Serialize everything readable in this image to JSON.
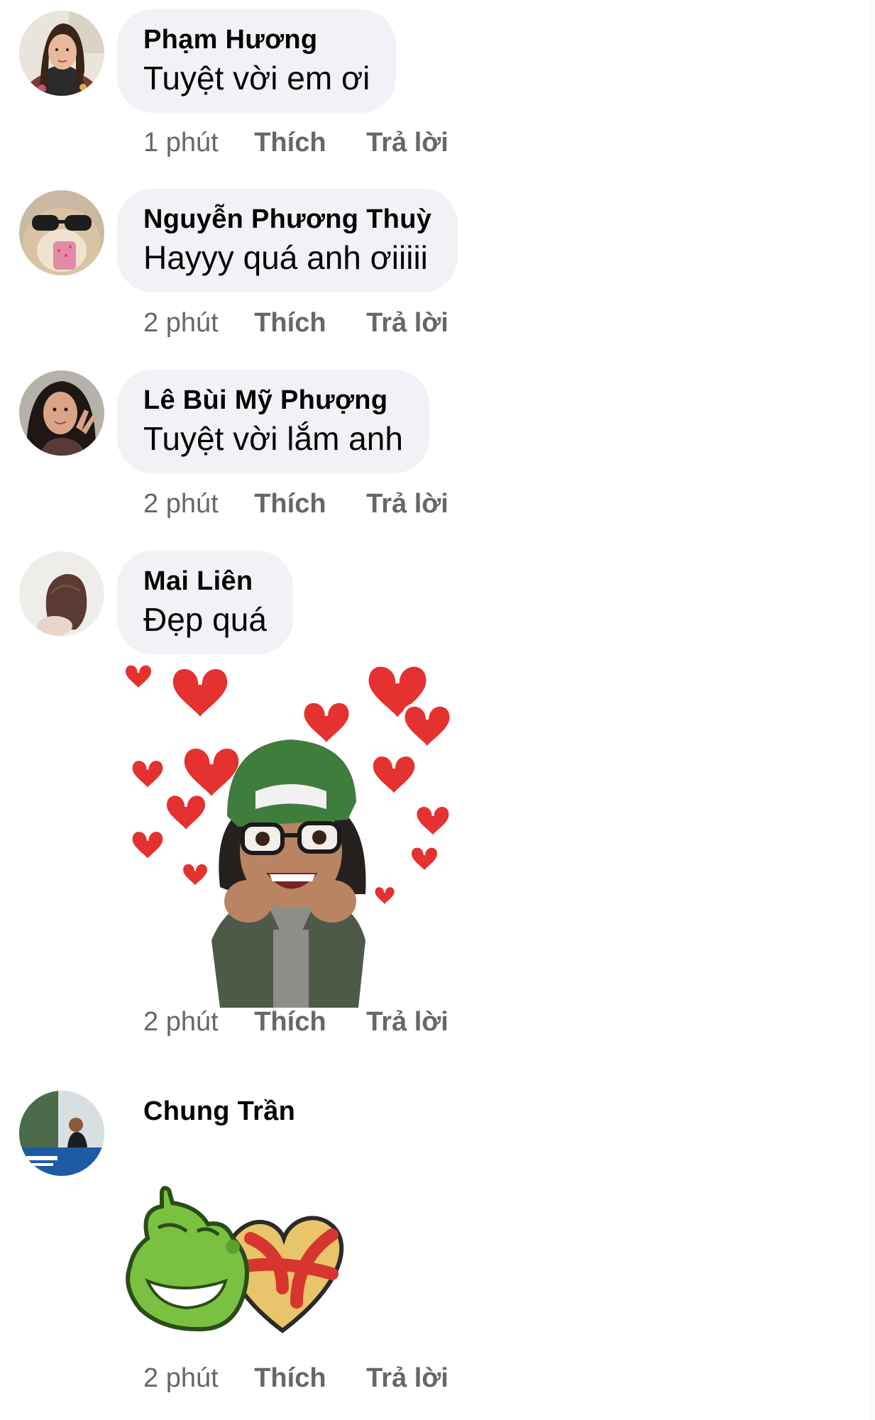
{
  "comments": [
    {
      "name": "Phạm Hương",
      "text": "Tuyệt vời em ơi",
      "time": "1 phút",
      "like": "Thích",
      "reply": "Trả lời",
      "avatar": "woman-portrait-avatar"
    },
    {
      "name": "Nguyễn Phương Thuỳ",
      "text": "Hayyy quá anh ơiiiii",
      "time": "2 phút",
      "like": "Thích",
      "reply": "Trả lời",
      "avatar": "hamster-sunglasses-avatar"
    },
    {
      "name": "Lê Bùi Mỹ Phượng",
      "text": "Tuyệt vời lắm anh",
      "time": "2 phút",
      "like": "Thích",
      "reply": "Trả lời",
      "avatar": "girl-peace-sign-avatar"
    },
    {
      "name": "Mai Liên",
      "text": "Đẹp quá",
      "time": "2 phút",
      "like": "Thích",
      "reply": "Trả lời",
      "avatar": "short-hair-woman-avatar",
      "sticker": "avatar-hearts-sticker"
    },
    {
      "name": "Chung Trần",
      "time": "2 phút",
      "like": "Thích",
      "reply": "Trả lời",
      "avatar": "man-outdoor-avatar",
      "sticker": "om-nom-candy-heart-sticker"
    }
  ],
  "colors": {
    "bubble": "#f0f2f5",
    "meta": "#65676b",
    "text": "#050505",
    "heart": "#e5312f"
  }
}
